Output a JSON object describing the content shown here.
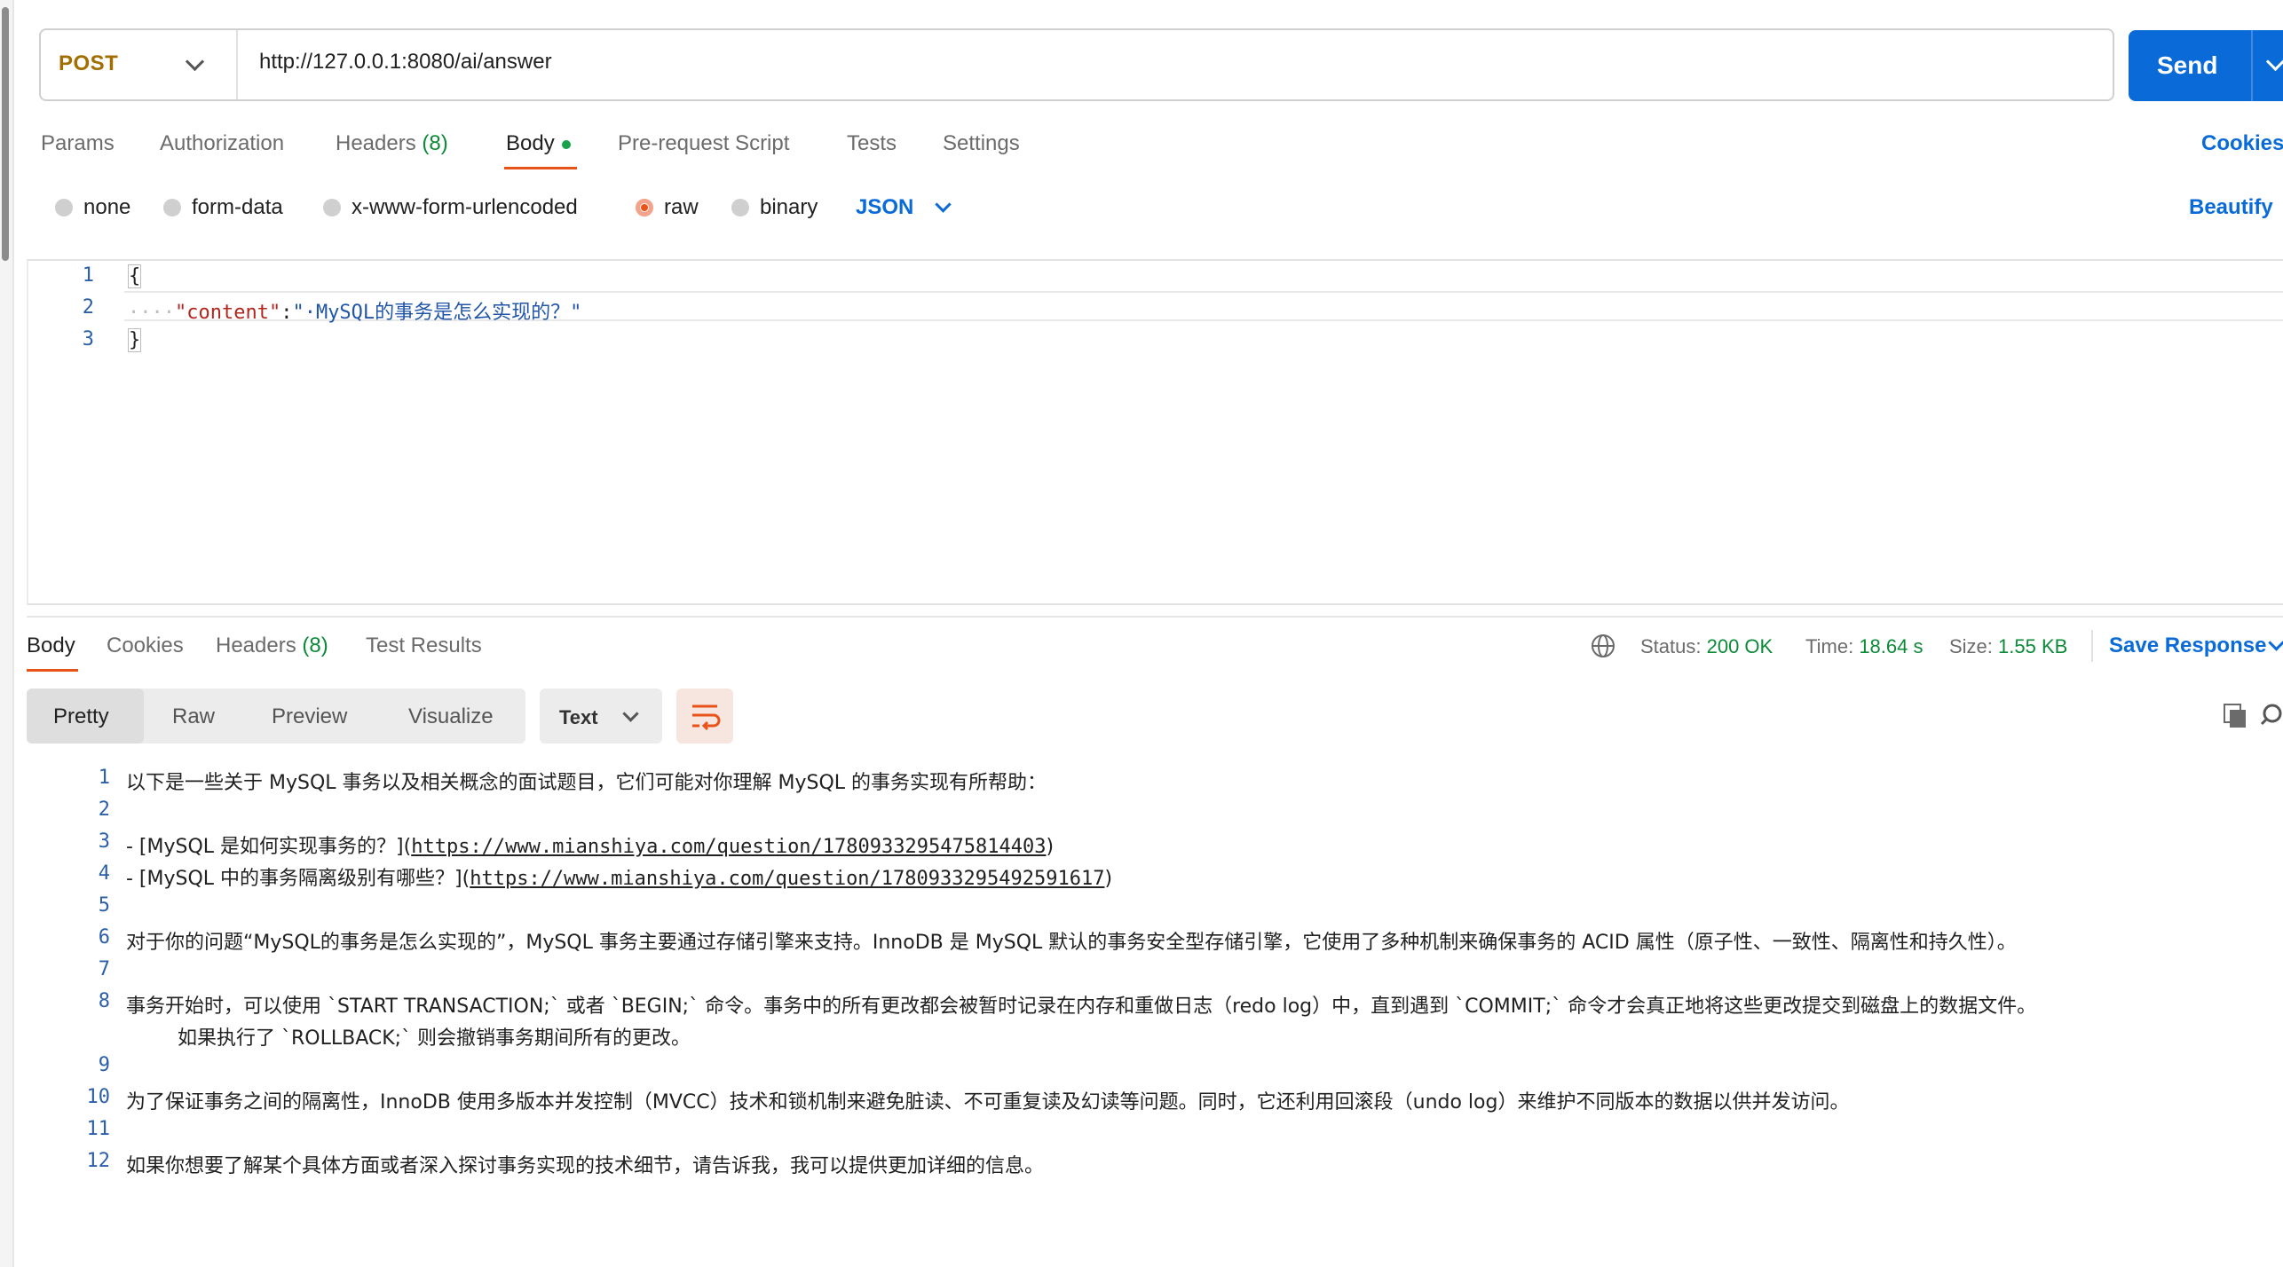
{
  "request": {
    "method": "POST",
    "url": "http://127.0.0.1:8080/ai/answer",
    "send_label": "Send"
  },
  "request_tabs": {
    "params": "Params",
    "authorization": "Authorization",
    "headers": "Headers",
    "headers_count": "(8)",
    "body": "Body",
    "prerequest": "Pre-request Script",
    "tests": "Tests",
    "settings": "Settings",
    "cookies": "Cookies"
  },
  "body_types": {
    "none": "none",
    "form_data": "form-data",
    "urlencoded": "x-www-form-urlencoded",
    "raw": "raw",
    "binary": "binary",
    "format": "JSON",
    "beautify": "Beautify",
    "selected": "raw"
  },
  "request_body": {
    "line_numbers": [
      "1",
      "2",
      "3"
    ],
    "open_brace": "{",
    "indent": "····",
    "key": "\"content\"",
    "colon": ":",
    "value": "\"·MySQL的事务是怎么实现的？\"",
    "close_brace": "}"
  },
  "response_tabs": {
    "body": "Body",
    "cookies": "Cookies",
    "headers": "Headers",
    "headers_count": "(8)",
    "test_results": "Test Results"
  },
  "response_meta": {
    "status_label": "Status:",
    "status_value": "200 OK",
    "time_label": "Time:",
    "time_value": "18.64 s",
    "size_label": "Size:",
    "size_value": "1.55 KB",
    "save_response": "Save Response"
  },
  "view_modes": {
    "pretty": "Pretty",
    "raw": "Raw",
    "preview": "Preview",
    "visualize": "Visualize",
    "format": "Text"
  },
  "response_body": {
    "line_numbers": [
      "1",
      "2",
      "3",
      "4",
      "5",
      "6",
      "7",
      "8",
      "9",
      "10",
      "11",
      "12"
    ],
    "l1": "以下是一些关于 MySQL 事务以及相关概念的面试题目，它们可能对你理解 MySQL 的事务实现有所帮助：",
    "l3_pre": "- [MySQL 是如何实现事务的？](",
    "l3_link": "https://www.mianshiya.com/question/1780933295475814403",
    "l3_post": ")",
    "l4_pre": "- [MySQL 中的事务隔离级别有哪些？](",
    "l4_link": "https://www.mianshiya.com/question/1780933295492591617",
    "l4_post": ")",
    "l6": "对于你的问题“MySQL的事务是怎么实现的”，MySQL 事务主要通过存储引擎来支持。InnoDB 是 MySQL 默认的事务安全型存储引擎，它使用了多种机制来确保事务的 ACID 属性（原子性、一致性、隔离性和持久性）。",
    "l8a": "事务开始时，可以使用 `START TRANSACTION;` 或者 `BEGIN;` 命令。事务中的所有更改都会被暂时记录在内存和重做日志（redo log）中，直到遇到 `COMMIT;` 命令才会真正地将这些更改提交到磁盘上的数据文件。",
    "l8b": "如果执行了 `ROLLBACK;` 则会撤销事务期间所有的更改。",
    "l10": "为了保证事务之间的隔离性，InnoDB 使用多版本并发控制（MVCC）技术和锁机制来避免脏读、不可重复读及幻读等问题。同时，它还利用回滚段（undo log）来维护不同版本的数据以供并发访问。",
    "l12": "如果你想要了解某个具体方面或者深入探讨事务实现的技术细节，请告诉我，我可以提供更加详细的信息。"
  }
}
